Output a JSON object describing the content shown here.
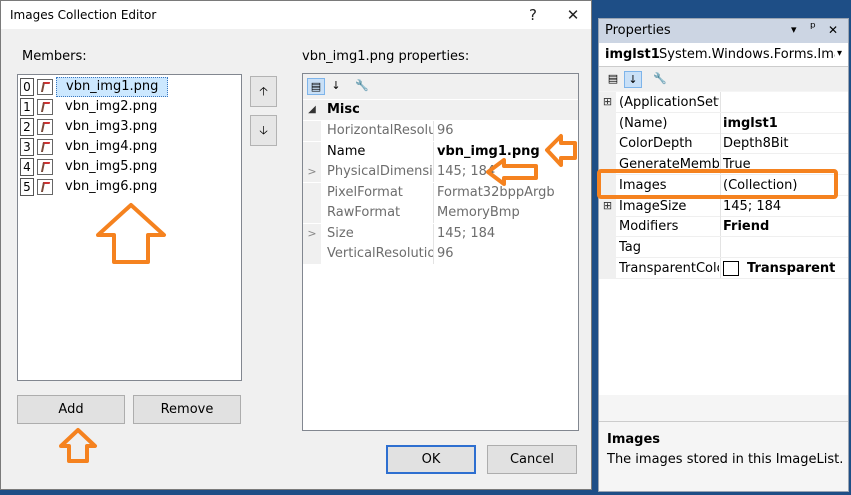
{
  "editor": {
    "title": "Images Collection Editor",
    "help_label": "?",
    "close_label": "✕",
    "members_label": "Members:",
    "members": [
      {
        "index": "0",
        "name": "vbn_img1.png"
      },
      {
        "index": "1",
        "name": "vbn_img2.png"
      },
      {
        "index": "2",
        "name": "vbn_img3.png"
      },
      {
        "index": "3",
        "name": "vbn_img4.png"
      },
      {
        "index": "4",
        "name": "vbn_img5.png"
      },
      {
        "index": "5",
        "name": "vbn_img6.png"
      }
    ],
    "move_up_label": "🡡",
    "move_down_label": "🡣",
    "add_label": "Add",
    "remove_label": "Remove",
    "properties_label": "vbn_img1.png properties:",
    "category": "Misc",
    "properties": [
      {
        "name": "HorizontalResolution",
        "value": "96",
        "expander": ""
      },
      {
        "name": "Name",
        "value": "vbn_img1.png",
        "expander": ""
      },
      {
        "name": "PhysicalDimension",
        "value": "145; 184",
        "expander": ">"
      },
      {
        "name": "PixelFormat",
        "value": "Format32bppArgb",
        "expander": ""
      },
      {
        "name": "RawFormat",
        "value": "MemoryBmp",
        "expander": ""
      },
      {
        "name": "Size",
        "value": "145; 184",
        "expander": ">"
      },
      {
        "name": "VerticalResolution",
        "value": "96",
        "expander": ""
      }
    ],
    "ok_label": "OK",
    "cancel_label": "Cancel"
  },
  "properties_window": {
    "title": "Properties",
    "dropdown_glyph": "▾",
    "pin_glyph": "ᵖ",
    "close_glyph": "✕",
    "object_name": "imglst1",
    "object_type": "System.Windows.Forms.ImageList",
    "rows": [
      {
        "name": "(ApplicationSettings)",
        "value": "",
        "expander": "⊞",
        "bold": false
      },
      {
        "name": "(Name)",
        "value": "imglst1",
        "expander": "",
        "bold": true
      },
      {
        "name": "ColorDepth",
        "value": "Depth8Bit",
        "expander": "",
        "bold": false
      },
      {
        "name": "GenerateMember",
        "value": "True",
        "expander": "",
        "bold": false
      },
      {
        "name": "Images",
        "value": "(Collection)",
        "expander": "",
        "bold": false
      },
      {
        "name": "ImageSize",
        "value": "145; 184",
        "expander": "⊞",
        "bold": false
      },
      {
        "name": "Modifiers",
        "value": "Friend",
        "expander": "",
        "bold": true
      },
      {
        "name": "Tag",
        "value": "",
        "expander": "",
        "bold": false
      },
      {
        "name": "TransparentColor",
        "value": "Transparent",
        "expander": "",
        "bold": true
      }
    ],
    "desc_title": "Images",
    "desc_text": "The images stored in this ImageList."
  },
  "colors": {
    "highlight_orange": "#f5821f",
    "selection_blue": "#cce8ff",
    "background_blue": "#1e4e86"
  }
}
